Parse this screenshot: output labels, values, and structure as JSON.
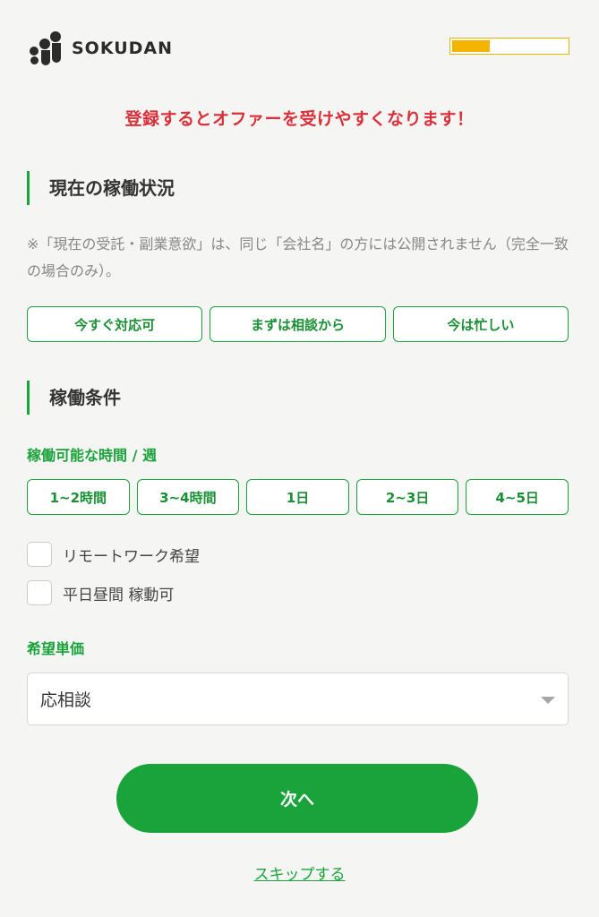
{
  "header": {
    "logo_text": "SOKUDAN",
    "progress_fraction": 0.33,
    "progress_color": "#f5b400"
  },
  "promo_text": "登録するとオファーを受けやすくなります！",
  "status_section": {
    "title": "現在の稼働状況",
    "note": "※「現在の受託・副業意欲」は、同じ「会社名」の方には公開されません（完全一致の場合のみ）。",
    "options": [
      "今すぐ対応可",
      "まずは相談から",
      "今は忙しい"
    ]
  },
  "conditions_section": {
    "title": "稼働条件",
    "hours_label": "稼働可能な時間 / 週",
    "hours_options": [
      "1~2時間",
      "3~4時間",
      "1日",
      "2~3日",
      "4~5日"
    ],
    "checkboxes": [
      "リモートワーク希望",
      "平日昼間 稼動可"
    ],
    "rate_label": "希望単価",
    "rate_selected": "応相談"
  },
  "actions": {
    "next_label": "次へ",
    "skip_label": "スキップする"
  },
  "colors": {
    "accent": "#1aa33b",
    "promo": "#d9303a",
    "background": "#f5f5f3"
  }
}
